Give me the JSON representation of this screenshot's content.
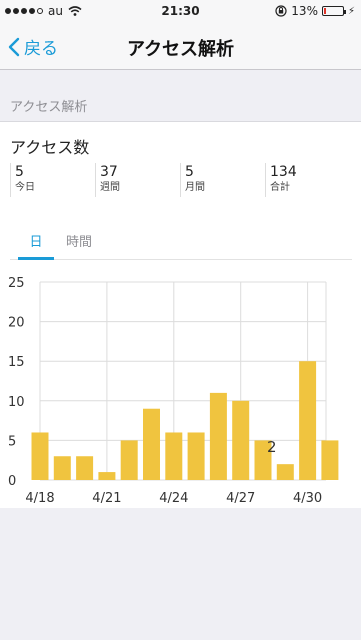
{
  "status": {
    "carrier": "au",
    "time": "21:30",
    "battery_text": "13%",
    "battery_level": 0.13
  },
  "nav": {
    "back_label": "戻る",
    "title": "アクセス解析"
  },
  "section": {
    "header": "アクセス解析"
  },
  "card": {
    "title": "アクセス数"
  },
  "stats": [
    {
      "value": "5",
      "label": "今日"
    },
    {
      "value": "37",
      "label": "週間"
    },
    {
      "value": "5",
      "label": "月間"
    },
    {
      "value": "134",
      "label": "合計"
    }
  ],
  "tabs": {
    "day": "日",
    "hour": "時間"
  },
  "colors": {
    "accent": "#1a9bd7",
    "bar": "#f0c43f",
    "grid": "#dcdcdc"
  },
  "chart_data": {
    "type": "bar",
    "categories": [
      "4/18",
      "4/19",
      "4/20",
      "4/21",
      "4/22",
      "4/23",
      "4/24",
      "4/25",
      "4/26",
      "4/27",
      "4/28",
      "4/29",
      "4/30",
      "5/1"
    ],
    "values": [
      6,
      3,
      3,
      1,
      5,
      9,
      6,
      6,
      11,
      10,
      5,
      2,
      15,
      5
    ],
    "x_tick_labels": [
      "4/18",
      "4/21",
      "4/24",
      "4/27",
      "4/30"
    ],
    "y_ticks": [
      0,
      5,
      10,
      15,
      20,
      25
    ],
    "ylim": [
      0,
      25
    ],
    "annotation": "2",
    "grid": true
  }
}
